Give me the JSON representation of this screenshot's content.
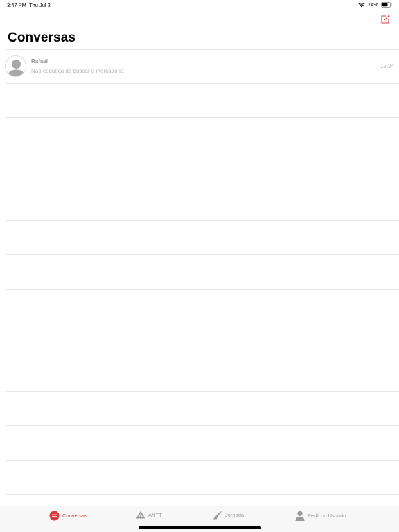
{
  "status_bar": {
    "time": "3:47 PM",
    "date": "Thu Jul 2",
    "battery": "74%",
    "battery_level": 0.74
  },
  "header": {
    "title": "Conversas",
    "compose_icon": "compose-icon"
  },
  "conversations": [
    {
      "name": "Rafael",
      "last_message": "Não esqueça de buscar a mercadoria",
      "time": "15:24"
    }
  ],
  "tabs": [
    {
      "label": "Conversas",
      "icon": "chat-bubble-icon",
      "active": true
    },
    {
      "label": "ANTT",
      "icon": "antt-logo-icon",
      "active": false
    },
    {
      "label": "Jornada",
      "icon": "road-icon",
      "active": false
    },
    {
      "label": "Perfil do Usuário",
      "icon": "user-icon",
      "active": false
    }
  ],
  "colors": {
    "accent": "#d8393b",
    "divider": "#e6e6e6",
    "tab_inactive": "#9b9b9b",
    "tab_bar_bg": "#f7f7f7"
  }
}
